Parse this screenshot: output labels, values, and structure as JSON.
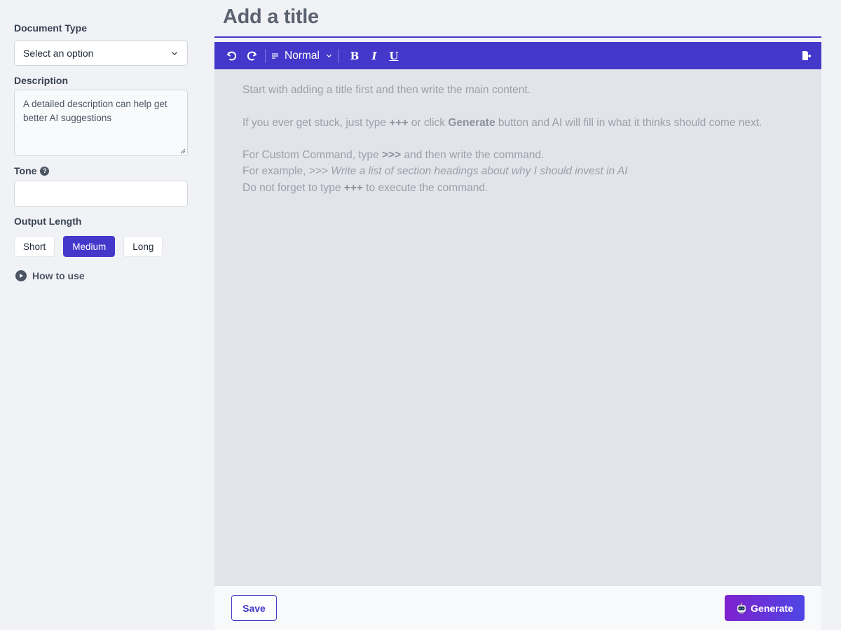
{
  "sidebar": {
    "document_type": {
      "label": "Document Type",
      "selected": "Select an option"
    },
    "description": {
      "label": "Description",
      "value": "A detailed description can help get better AI suggestions"
    },
    "tone": {
      "label": "Tone",
      "help_icon": "?",
      "value": ""
    },
    "output_length": {
      "label": "Output Length",
      "options": [
        "Short",
        "Medium",
        "Long"
      ],
      "selected": "Medium"
    },
    "how_to_use": "How to use"
  },
  "editor": {
    "title_placeholder": "Add a title",
    "toolbar": {
      "format": "Normal",
      "bold": "B",
      "italic": "I",
      "underline": "U",
      "icons": [
        "undo-icon",
        "redo-icon",
        "align-icon",
        "chevron-down-icon",
        "export-icon"
      ]
    },
    "placeholder": {
      "line1": "Start with adding a title first and then write the main content.",
      "line2_a": "If you ever get stuck, just type ",
      "line2_b": "+++",
      "line2_c": " or click ",
      "line2_d": "Generate",
      "line2_e": " button and AI will fill in what it thinks should come next.",
      "line3_a": "For Custom Command, type ",
      "line3_b": ">>>",
      "line3_c": " and then write the command.",
      "line4_a": "For example, ",
      "line4_b": ">>> Write a list of section headings about why I should invest in AI",
      "line5_a": "Do not forget to type ",
      "line5_b": "+++",
      "line5_c": " to execute the command."
    }
  },
  "footer": {
    "save": "Save",
    "generate": "Generate"
  },
  "colors": {
    "accent": "#4338ca",
    "generate_start": "#7e22ce",
    "generate_end": "#4f46e5"
  }
}
